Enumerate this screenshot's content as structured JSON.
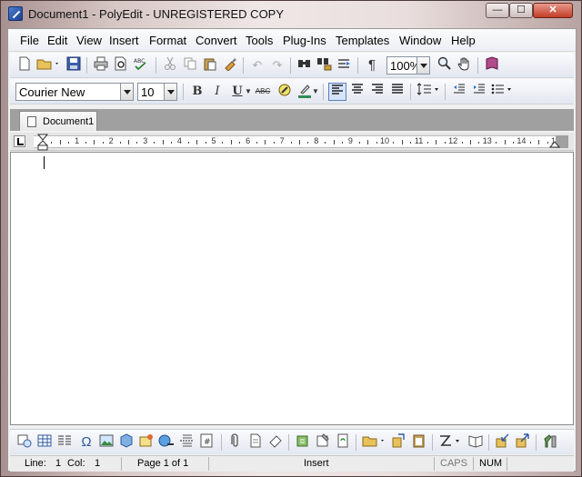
{
  "window": {
    "title": "Document1 - PolyEdit - UNREGISTERED COPY",
    "min_glyph": "—",
    "max_glyph": "☐",
    "close_glyph": "✕"
  },
  "menu": [
    "File",
    "Edit",
    "View",
    "Insert",
    "Format",
    "Convert",
    "Tools",
    "Plug-Ins",
    "Templates",
    "Window",
    "Help"
  ],
  "toolbar1": {
    "zoom": "100%"
  },
  "toolbar2": {
    "font": "Courier New",
    "size": "10",
    "bold": "B",
    "italic": "I",
    "underline": "U",
    "strike": "ABC"
  },
  "tabs": [
    {
      "label": "Document1"
    }
  ],
  "ruler": {
    "numbers": [
      "1",
      "2",
      "3",
      "4",
      "5",
      "6",
      "7",
      "8",
      "9",
      "10",
      "11",
      "12",
      "13",
      "14",
      "15"
    ]
  },
  "status": {
    "line_label": "Line:",
    "line_value": "1",
    "col_label": "Col:",
    "col_value": "1",
    "page": "Page 1 of 1",
    "mode": "Insert",
    "caps": "CAPS",
    "num": "NUM"
  },
  "colors": {
    "accent": "#1b3f8f",
    "highlight": "#2d6bd6",
    "font_color": "#2e8b57"
  }
}
